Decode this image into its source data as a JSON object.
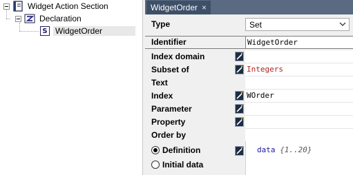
{
  "tree": {
    "root": {
      "label": "Widget Action Section",
      "icon": "book-icon"
    },
    "declaration": {
      "label": "Declaration",
      "icon": "declaration-icon"
    },
    "item": {
      "label": "WidgetOrder",
      "icon_letter": "S"
    }
  },
  "tab": {
    "label": "WidgetOrder",
    "close": "×"
  },
  "attributes": {
    "type": {
      "name": "Type",
      "value": "Set"
    },
    "identifier": {
      "name": "Identifier",
      "value": "WidgetOrder"
    },
    "index_domain": {
      "name": "Index domain",
      "value": ""
    },
    "subset_of": {
      "name": "Subset of",
      "value": "Integers"
    },
    "text": {
      "name": "Text",
      "value": ""
    },
    "index": {
      "name": "Index",
      "value": "WOrder"
    },
    "parameter": {
      "name": "Parameter",
      "value": ""
    },
    "property": {
      "name": "Property",
      "value": ""
    },
    "order_by": {
      "name": "Order by",
      "value": ""
    },
    "definition": {
      "name": "Definition",
      "selected": true,
      "keyword": "data",
      "range": "{1..20}"
    },
    "initial_data": {
      "name": "Initial data",
      "selected": false
    }
  },
  "colors": {
    "tab_active": "#3e4f68",
    "tabbar": "#5a6a80",
    "value_red": "#b22222",
    "keyword_blue": "#1a1aa0"
  }
}
